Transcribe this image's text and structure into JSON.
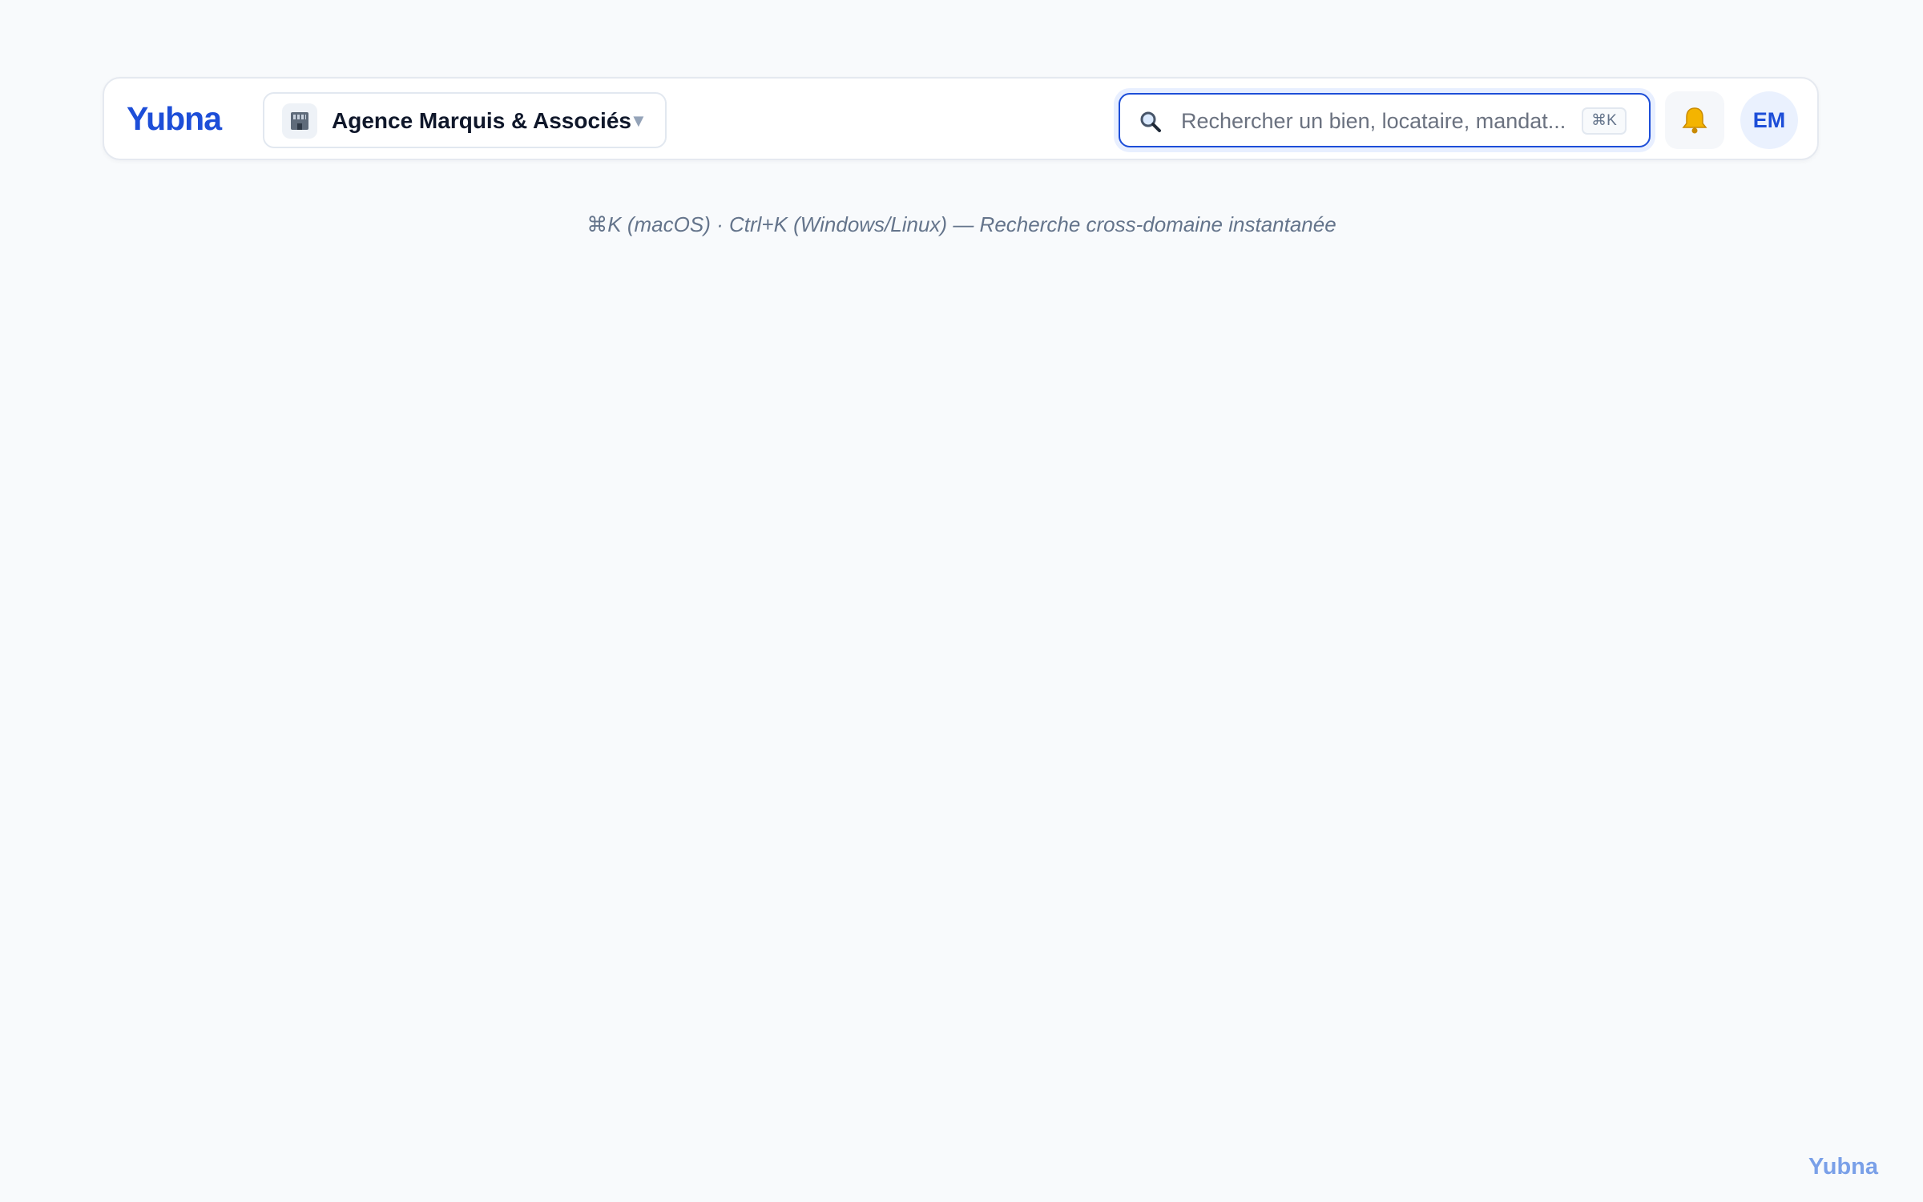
{
  "header": {
    "brand": "Yubna",
    "org_switcher": {
      "icon": "office-building-icon",
      "label": "Agence Marquis & Associés",
      "caret_icon": "chevron-down-icon",
      "caret": "▼"
    },
    "search": {
      "icon": "search-icon",
      "placeholder": "Rechercher un bien, locataire, mandat...",
      "value": "",
      "shortcut": "⌘K"
    },
    "notifications": {
      "icon": "bell-icon"
    },
    "avatar": {
      "initials": "EM"
    }
  },
  "hint": "⌘K (macOS) · Ctrl+K (Windows/Linux) — Recherche cross-domaine instantanée",
  "footer": {
    "watermark": "Yubna"
  },
  "colors": {
    "brand": "#1d4ed8",
    "background": "#f8fafc",
    "focus_ring": "#e8efff"
  }
}
